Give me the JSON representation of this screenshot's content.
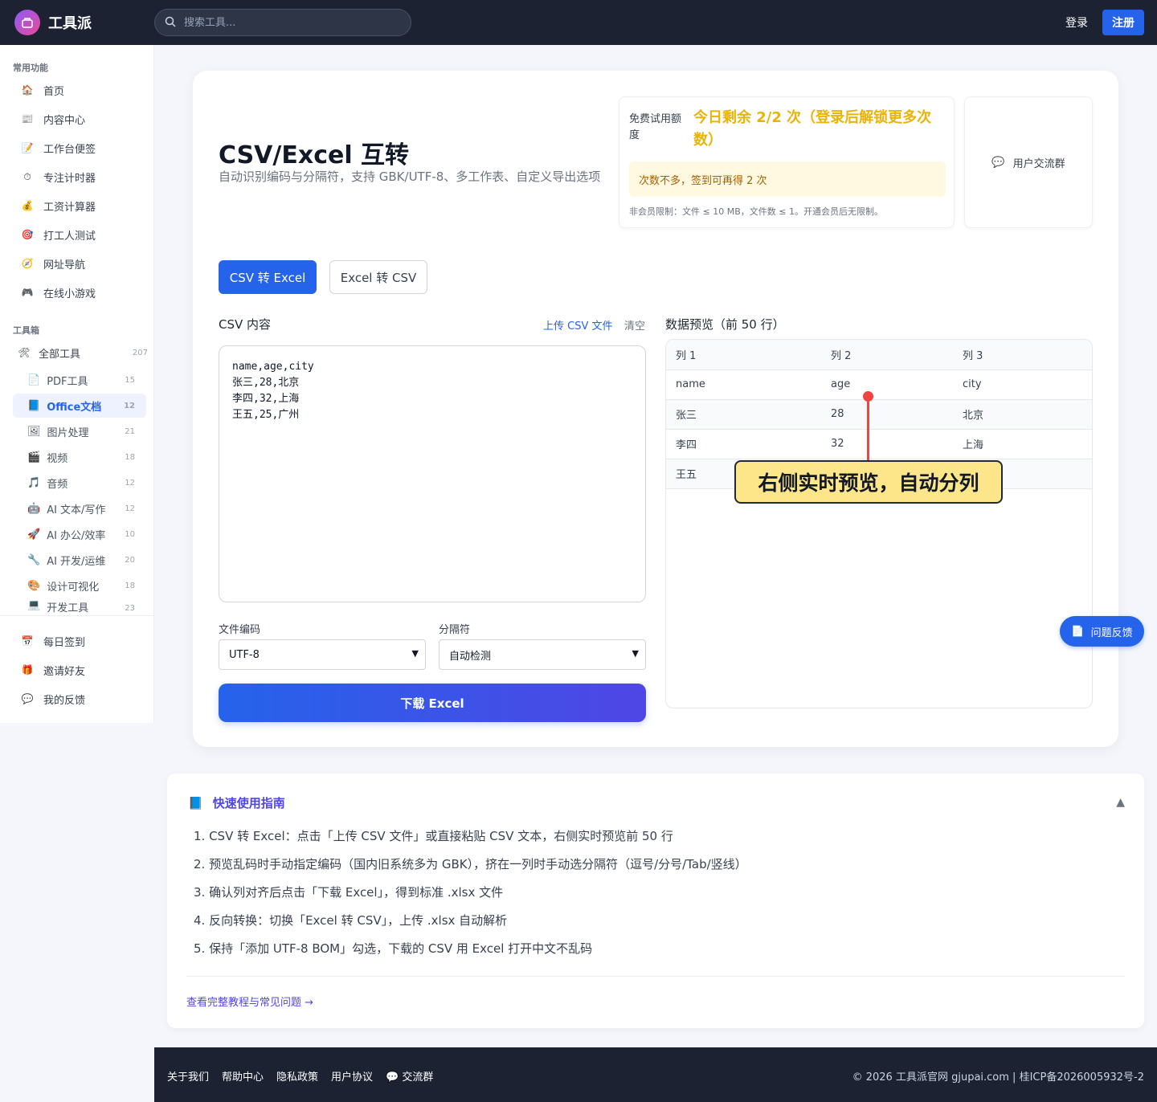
{
  "header": {
    "app_name": "工具派",
    "search_placeholder": "搜索工具...",
    "login": "登录",
    "register": "注册"
  },
  "sidebar": {
    "section_common": "常用功能",
    "common_items": [
      {
        "label": "首页",
        "icon": "home-icon"
      },
      {
        "label": "内容中心",
        "icon": "news-icon"
      },
      {
        "label": "工作台便签",
        "icon": "note-icon"
      },
      {
        "label": "专注计时器",
        "icon": "timer-icon"
      },
      {
        "label": "工资计算器",
        "icon": "money-bag-icon"
      },
      {
        "label": "打工人测试",
        "icon": "target-icon"
      },
      {
        "label": "网址导航",
        "icon": "compass-icon"
      },
      {
        "label": "在线小游戏",
        "icon": "gamepad-icon"
      }
    ],
    "section_tools": "工具箱",
    "all_tools": {
      "label": "全部工具",
      "count": "207"
    },
    "categories": [
      {
        "label": "PDF工具",
        "count": "15",
        "active": false
      },
      {
        "label": "Office文档",
        "count": "12",
        "active": true
      },
      {
        "label": "图片处理",
        "count": "21",
        "active": false
      },
      {
        "label": "视频",
        "count": "18",
        "active": false
      },
      {
        "label": "音频",
        "count": "12",
        "active": false
      },
      {
        "label": "AI 文本/写作",
        "count": "12",
        "active": false
      },
      {
        "label": "AI 办公/效率",
        "count": "10",
        "active": false
      },
      {
        "label": "AI 开发/运维",
        "count": "20",
        "active": false
      },
      {
        "label": "设计可视化",
        "count": "18",
        "active": false
      },
      {
        "label": "开发工具",
        "count": "23",
        "active": false
      }
    ],
    "bottom_items": [
      {
        "label": "每日签到",
        "icon": "calendar-icon"
      },
      {
        "label": "邀请好友",
        "icon": "gift-icon"
      },
      {
        "label": "我的反馈",
        "icon": "speech-bubble-icon"
      }
    ]
  },
  "tool": {
    "title": "CSV/Excel 互转",
    "subtitle": "自动识别编码与分隔符，支持 GBK/UTF-8、多工作表、自定义导出选项",
    "quota_label": "免费试用额度",
    "quota_value": "今日剩余 2/2 次（登录后解锁更多次数）",
    "quota_note": "次数不多，签到可再得 2 次",
    "quota_limit": "非会员限制：文件 ≤ 10 MB，文件数 ≤ 1。开通会员后无限制。",
    "group_label": "用户交流群",
    "tabs": [
      "CSV 转 Excel",
      "Excel 转 CSV"
    ],
    "csv_label": "CSV 内容",
    "upload_label": "上传 CSV 文件",
    "clear_label": "清空",
    "csv_content": "name,age,city\n张三,28,北京\n李四,32,上海\n王五,25,广州",
    "encoding_label": "文件编码",
    "encoding_value": "UTF-8",
    "delimiter_label": "分隔符",
    "delimiter_value": "自动检测",
    "download_label": "下载 Excel",
    "preview_label": "数据预览（前 50 行）",
    "preview_headers": [
      "列 1",
      "列 2",
      "列 3"
    ],
    "preview_rows": [
      [
        "name",
        "age",
        "city"
      ],
      [
        "张三",
        "28",
        "北京"
      ],
      [
        "李四",
        "32",
        "上海"
      ],
      [
        "王五",
        "",
        ""
      ]
    ],
    "callout": "右侧实时预览，自动分列",
    "feedback": "问题反馈"
  },
  "guide": {
    "title": "快速使用指南",
    "steps": [
      "1. CSV 转 Excel：点击「上传 CSV 文件」或直接粘贴 CSV 文本，右侧实时预览前 50 行",
      "2. 预览乱码时手动指定编码（国内旧系统多为 GBK），挤在一列时手动选分隔符（逗号/分号/Tab/竖线）",
      "3. 确认列对齐后点击「下载 Excel」，得到标准 .xlsx 文件",
      "4. 反向转换：切换「Excel 转 CSV」，上传 .xlsx 自动解析",
      "5. 保持「添加 UTF-8 BOM」勾选，下载的 CSV 用 Excel 打开中文不乱码"
    ],
    "more_link": "查看完整教程与常见问题 →"
  },
  "footer": {
    "links": [
      "关于我们",
      "帮助中心",
      "隐私政策",
      "用户协议",
      "交流群"
    ],
    "copyright": "© 2026 工具派官网 gjupai.com | 桂ICP备2026005932号-2"
  },
  "colors": {
    "primary": "#2563eb",
    "accent": "#4f46e5",
    "nav_bg": "#1c2232",
    "quota": "#eab308",
    "callout_bg": "#fde68a",
    "callout_line": "#ef4444"
  }
}
